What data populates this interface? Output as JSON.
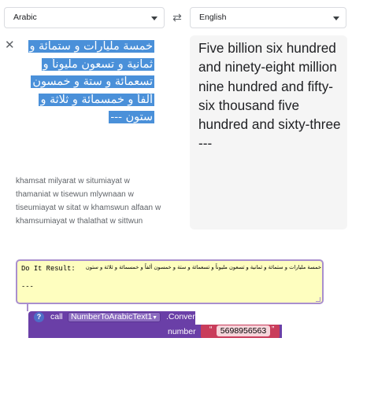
{
  "translator": {
    "source_language": "Arabic",
    "target_language": "English",
    "source_text_arabic": "خمسة مليارات و ستمائة و ثمانية و تسعون مليوناً و تسعمائة و ستة و خمسون ألفاً و خمسمائة و ثلاثة و ستون ---",
    "romanization": "khamsat milyarat w situmiayat w thamaniat w tisewun mlywnaan w tiseumiayat w sitat w khamswun alfaan w khamsumiayat w thalathat w sittwun",
    "english_output": "Five billion six hundred and ninety-eight million nine hundred and fifty-six thousand five hundred and sixty-three\n---"
  },
  "blocks": {
    "comment_label": "Do It Result:",
    "comment_arabic": "خمسة مليارات و ستمائة و ثمانية و تسعون مليوناً و تسعمائة و ستة و خمسون ألفاً و خمسمائة و ثلاثة و ستون",
    "comment_dashes": "---",
    "help_label": "?",
    "call_label": "call",
    "component_name": "NumberToArabicText1",
    "method_label": ".Convert",
    "param_label": "number",
    "param_value": "5698956563"
  },
  "icons": {
    "swap": "swap-arrows-icon",
    "clear": "close-icon",
    "dropdown": "caret-down-icon"
  },
  "colors": {
    "highlight": "#4a90d9",
    "procedure_block": "#6a3fa7",
    "text_block": "#c93d5b",
    "comment_bg": "#fefebf"
  }
}
